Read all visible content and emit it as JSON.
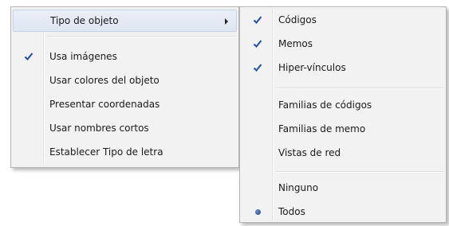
{
  "main_menu": {
    "items": [
      {
        "label": "Tipo de objeto",
        "has_submenu": true,
        "highlighted": true
      },
      {
        "label": "Usa imágenes",
        "checked": true
      },
      {
        "label": "Usar colores del objeto",
        "checked": false
      },
      {
        "label": "Presentar coordenadas",
        "checked": false
      },
      {
        "label": "Usar nombres cortos",
        "checked": false
      },
      {
        "label": "Establecer Tipo de letra",
        "checked": false
      }
    ]
  },
  "sub_menu": {
    "items": [
      {
        "label": "Códigos",
        "checked": true
      },
      {
        "label": "Memos",
        "checked": true
      },
      {
        "label": "Hiper-vínculos",
        "checked": true
      },
      {
        "label": "Familias de códigos",
        "checked": false
      },
      {
        "label": "Familias de memo",
        "checked": false
      },
      {
        "label": "Vistas de red",
        "checked": false
      },
      {
        "label": "Ninguno",
        "selected": false
      },
      {
        "label": "Todos",
        "selected": true
      }
    ]
  },
  "icons": {
    "check": "checkmark-icon",
    "radio": "radio-dot-icon",
    "submenu": "submenu-arrow-icon"
  },
  "colors": {
    "check": "#1f4fa8",
    "highlight": "#dfe7f3"
  }
}
